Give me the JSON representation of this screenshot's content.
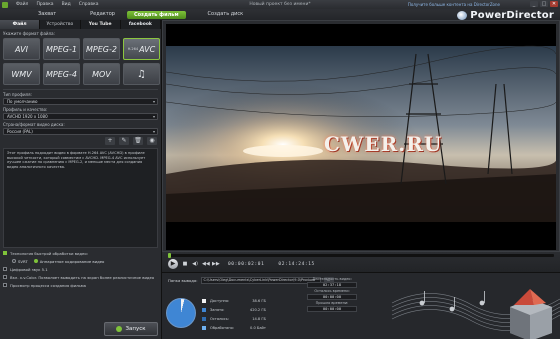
{
  "window": {
    "menu": [
      "Файл",
      "Правка",
      "Вид",
      "Справка"
    ],
    "title": "Новый проект без имени*",
    "link": "Получите больше контента на DirectorZone",
    "buttons": {
      "minimize": "_",
      "maximize": "□",
      "close": "✕"
    }
  },
  "modes": {
    "capture": "Захват",
    "edit": "Редактор",
    "produce": "Создать фильм",
    "disc": "Создать диск"
  },
  "brand": {
    "name": "PowerDirector"
  },
  "subtabs": {
    "file": "Файл",
    "device": "Устройство",
    "youtube": "You Tube",
    "facebook": "facebook"
  },
  "format_section": {
    "label": "Укажите формат файла:",
    "formats": [
      "AVI",
      "MPEG-1",
      "MPEG-2",
      "AVC",
      "WMV",
      "MPEG-4",
      "MOV",
      "♫"
    ],
    "avc_prefix": "H.264",
    "selected": "AVC"
  },
  "profile": {
    "type_label": "Тип профиля:",
    "type_value": "По умолчанию",
    "quality_label": "Профиль и качество:",
    "quality_value": "AVCHD 1920 x 1080",
    "country_label": "Страна/формат видео диска:",
    "country_value": "Россия (PAL)"
  },
  "profile_actions": {
    "add": "+",
    "edit": "✎",
    "delete": "🗑",
    "details": "◉"
  },
  "description": "Этот профиль подходит видео в формате H.264 AVC (AVCHD) в профиле высокой четкости, который совместим с AVCHD. MPEG-4 AVC использует лучшее сжатие по сравнению с MPEG-2, и меньше места для создания видео аналогичного качества.",
  "options": {
    "fast_render": "Технология быстрой обработки видео:",
    "svrt": "SVRT",
    "hw_encoding": "Аппаратное кодирование видео",
    "surround": "Цифровой звук 5.1",
    "xvcolor": "Вкл. x.v.Color. Позволяет выводить на экран более реалистичное видео",
    "preview": "Просмотр процесса создания фильма"
  },
  "start_button": "Запуск",
  "watermark": "CWER.RU",
  "player": {
    "play": "▶",
    "stop": "■",
    "volume": "◀)",
    "prev": "◀◀",
    "next": "▶▶",
    "timecode": "00:00:02:01",
    "duration": "02:14:24:15",
    "progress": 0.0
  },
  "output": {
    "label": "Папка вывода:",
    "path": "C:\\Users\\Oleg\\Documents\\CyberLink\\PowerDirector\\9.0\\Produce",
    "browse": "..."
  },
  "disk": {
    "items": [
      {
        "name": "Доступно:",
        "value": "38.6 ГБ",
        "color": "#f1f2f4"
      },
      {
        "name": "Занято:",
        "value": "420.2 ГБ",
        "color": "#3f86d4"
      },
      {
        "name": "Осталось:",
        "value": "14.8 ГБ",
        "color": "#2f6db2"
      },
      {
        "name": "Обработано:",
        "value": "0.0 Байт",
        "color": "#6fb1f0"
      }
    ],
    "free_fraction": 0.04
  },
  "times": {
    "duration_label": "Длительность видео:",
    "duration_value": "02:37:18",
    "remaining_label": "Осталось времени:",
    "remaining_value": "00:00:00",
    "elapsed_label": "Прошло времени:",
    "elapsed_value": "00:00:00"
  },
  "colors": {
    "accent": "#7fc33a",
    "panel": "#2a2c30",
    "background": "#1d1f22"
  }
}
